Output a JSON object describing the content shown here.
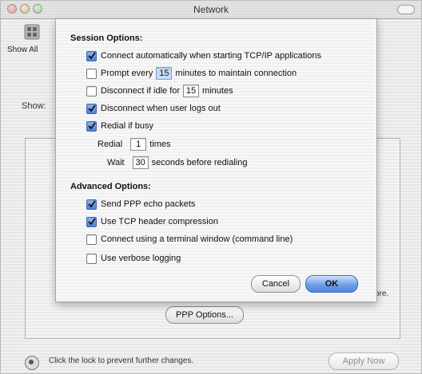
{
  "window": {
    "title": "Network"
  },
  "toolbar": {
    "show_all": "Show All"
  },
  "show_label": "Show:",
  "sheet": {
    "session_title": "Session Options:",
    "items": {
      "connect_auto": "Connect automatically when starting TCP/IP applications",
      "prompt_pre": "Prompt every",
      "prompt_val": "15",
      "prompt_post": "minutes to maintain connection",
      "disconnect_idle_pre": "Disconnect if idle for",
      "disconnect_idle_val": "15",
      "disconnect_idle_post": "minutes",
      "disconnect_logout": "Disconnect when user logs out",
      "redial": "Redial if busy",
      "redial_label": "Redial",
      "redial_times_val": "1",
      "redial_times_post": "times",
      "wait_label": "Wait",
      "wait_val": "30",
      "wait_post": "seconds before redialing"
    },
    "advanced_title": "Advanced Options:",
    "advanced": {
      "echo": "Send PPP echo packets",
      "tcp": "Use TCP header compression",
      "terminal": "Connect using a terminal window (command line)",
      "verbose": "Use verbose logging"
    },
    "buttons": {
      "cancel": "Cancel",
      "ok": "OK"
    },
    "states": {
      "connect_auto": true,
      "prompt": false,
      "disconnect_idle": false,
      "disconnect_logout": true,
      "redial": true,
      "echo": true,
      "tcp": true,
      "terminal": false,
      "verbose": false
    }
  },
  "background": {
    "ppp_options": "PPP Options...",
    "lock_text": "Click the lock to prevent further changes.",
    "apply_now": "Apply Now",
    "more_text": "ore."
  }
}
